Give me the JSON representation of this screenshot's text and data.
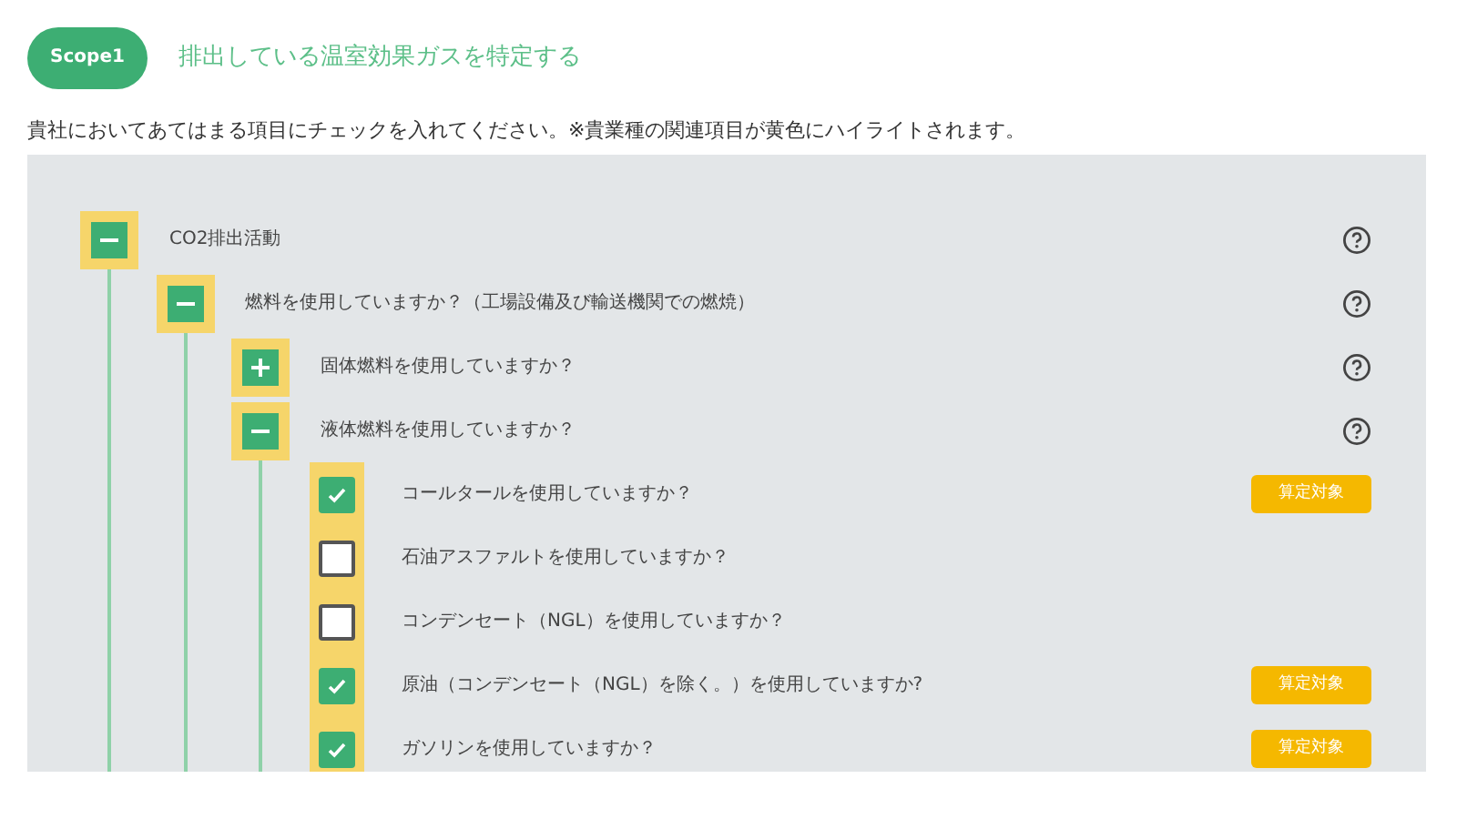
{
  "header": {
    "scope_badge": "Scope1",
    "title": "排出している温室効果ガスを特定する"
  },
  "instruction": "貴社においてあてはまる項目にチェックを入れてください。※貴業種の関連項目が黄色にハイライトされます。",
  "tree": [
    {
      "kind": "group",
      "label": "CO2排出活動",
      "expanded": true,
      "highlighted": true,
      "help": true,
      "children": [
        {
          "kind": "group",
          "label": "燃料を使用していますか？（工場設備及び輸送機関での燃焼）",
          "expanded": true,
          "highlighted": true,
          "help": true,
          "children": [
            {
              "kind": "group",
              "label": "固体燃料を使用していますか？",
              "expanded": false,
              "highlighted": true,
              "help": true
            },
            {
              "kind": "group",
              "label": "液体燃料を使用していますか？",
              "expanded": true,
              "highlighted": true,
              "help": true,
              "children": [
                {
                  "kind": "question",
                  "label": "コールタールを使用していますか？",
                  "checked": true,
                  "highlighted": true,
                  "badge": "算定対象"
                },
                {
                  "kind": "question",
                  "label": "石油アスファルトを使用していますか？",
                  "checked": false,
                  "highlighted": true
                },
                {
                  "kind": "question",
                  "label": "コンデンセート（NGL）を使用していますか？",
                  "checked": false,
                  "highlighted": true
                },
                {
                  "kind": "question",
                  "label": "原油（コンデンセート（NGL）を除く。）を使用していますか?",
                  "checked": true,
                  "highlighted": true,
                  "badge": "算定対象"
                },
                {
                  "kind": "question",
                  "label": "ガソリンを使用していますか？",
                  "checked": true,
                  "highlighted": true,
                  "badge": "算定対象"
                }
              ]
            }
          ]
        }
      ]
    }
  ]
}
